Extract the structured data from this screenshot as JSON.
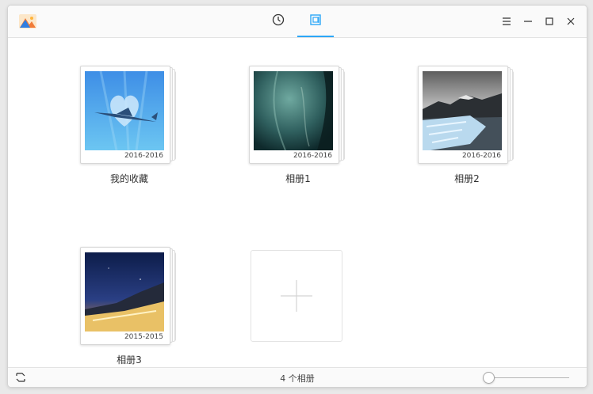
{
  "titlebar": {
    "tabs": [
      {
        "icon": "clock-icon",
        "active": false
      },
      {
        "icon": "album-view-icon",
        "active": true
      }
    ],
    "window_controls": [
      "menu-icon",
      "minimize-icon",
      "maximize-icon",
      "close-icon"
    ]
  },
  "albums": [
    {
      "name": "我的收藏",
      "date": "2016-2016"
    },
    {
      "name": "相册1",
      "date": "2016-2016"
    },
    {
      "name": "相册2",
      "date": "2016-2016"
    },
    {
      "name": "相册3",
      "date": "2015-2015"
    }
  ],
  "add_album": {
    "icon": "plus-icon"
  },
  "status": {
    "count_text": "4 个相册",
    "zoom_level": 0
  },
  "colors": {
    "accent": "#2ca7f8"
  }
}
